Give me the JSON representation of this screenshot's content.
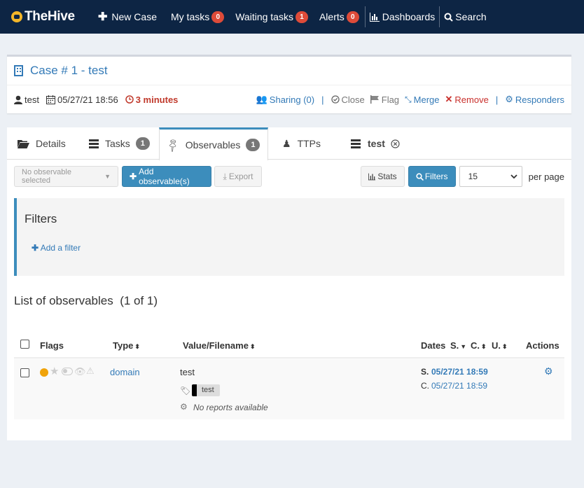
{
  "navbar": {
    "brand": "TheHive",
    "new_case": "New Case",
    "my_tasks": "My tasks",
    "my_tasks_count": "0",
    "waiting_tasks": "Waiting tasks",
    "waiting_tasks_count": "1",
    "alerts": "Alerts",
    "alerts_count": "0",
    "dashboards": "Dashboards",
    "search": "Search"
  },
  "case": {
    "title": "Case # 1 - test",
    "owner": "test",
    "date": "05/27/21 18:56",
    "duration": "3 minutes",
    "sharing": "Sharing (0)",
    "close": "Close",
    "flag": "Flag",
    "merge": "Merge",
    "remove": "Remove",
    "responders": "Responders"
  },
  "tabs": [
    {
      "label": "Details"
    },
    {
      "label": "Tasks",
      "badge": "1"
    },
    {
      "label": "Observables",
      "badge": "1"
    },
    {
      "label": "TTPs"
    },
    {
      "label": "test"
    }
  ],
  "toolbar": {
    "selection": "No observable selected",
    "add": "Add observable(s)",
    "export": "Export",
    "stats": "Stats",
    "filters": "Filters",
    "per_page_value": "15",
    "per_page_label": "per page"
  },
  "filters": {
    "title": "Filters",
    "add_filter": "Add a filter"
  },
  "list": {
    "title": "List of observables  (1 of 1)",
    "columns": {
      "flags": "Flags",
      "type": "Type",
      "value": "Value/Filename",
      "dates": "Dates",
      "s": "S.",
      "c": "C.",
      "u": "U.",
      "actions": "Actions"
    },
    "rows": [
      {
        "type": "domain",
        "value": "test",
        "tag": "test",
        "reports": "No reports available",
        "s_label": "S.",
        "s_date": "05/27/21 18:59",
        "c_label": "C.",
        "c_date": "05/27/21 18:59"
      }
    ]
  },
  "colors": {
    "navbar_bg": "#0d2544",
    "accent": "#3c8dbc",
    "badge_red": "#dd4b39",
    "tlp_amber": "#f0a30a"
  }
}
